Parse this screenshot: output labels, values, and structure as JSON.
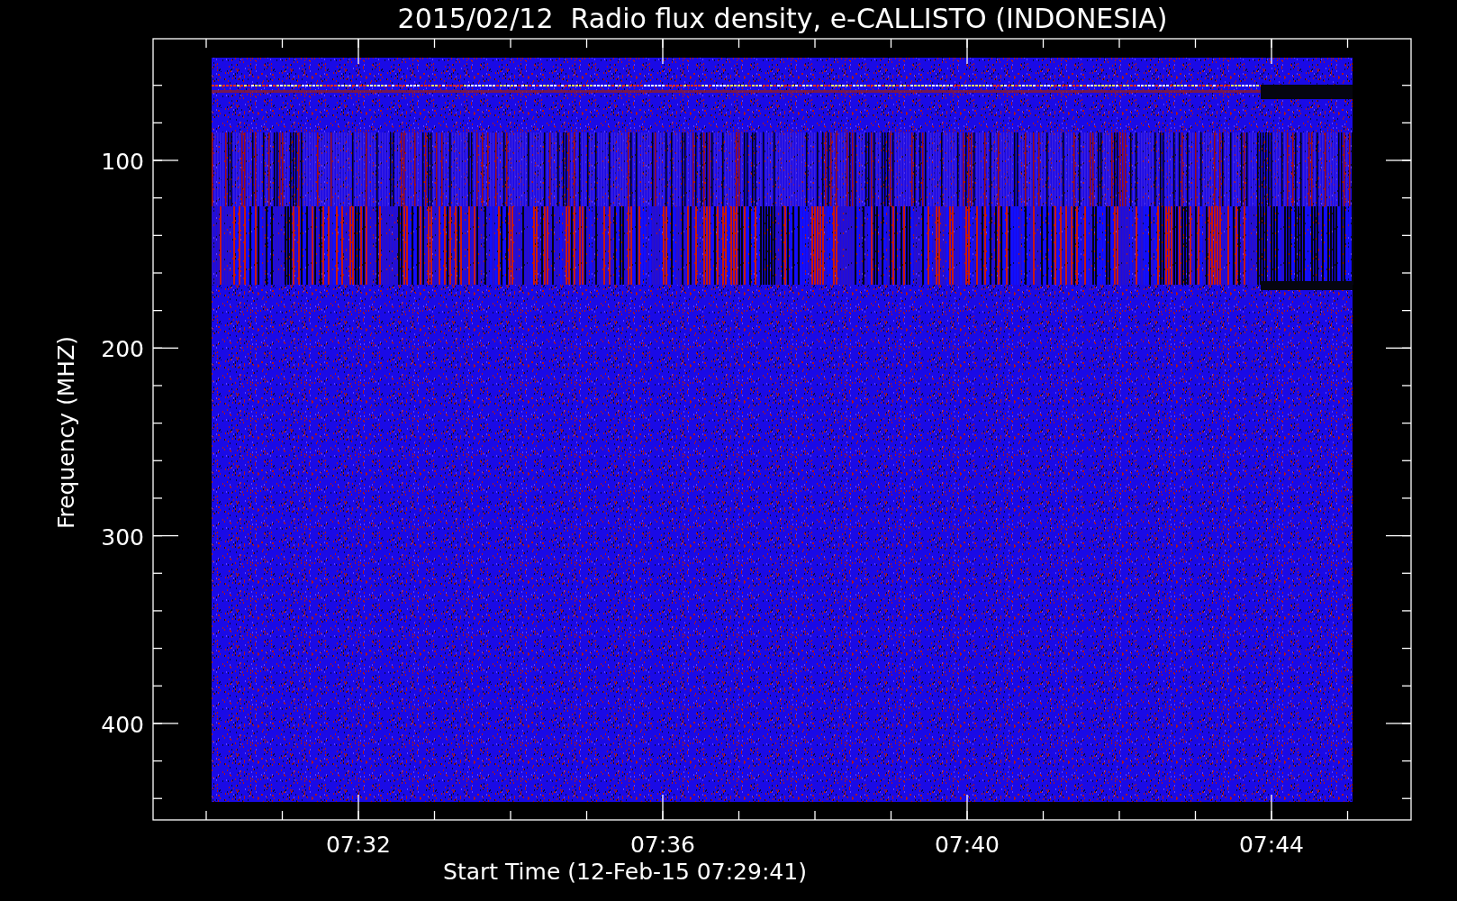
{
  "title": "2015/02/12  Radio flux density, e-CALLISTO (INDONESIA)",
  "y_axis": {
    "label": "Frequency (MHZ)",
    "ticks": [
      "100",
      "200",
      "300",
      "400"
    ]
  },
  "x_axis": {
    "label": "Start Time (12-Feb-15 07:29:41)",
    "ticks": [
      "07:32",
      "07:36",
      "07:40",
      "07:44"
    ]
  }
}
